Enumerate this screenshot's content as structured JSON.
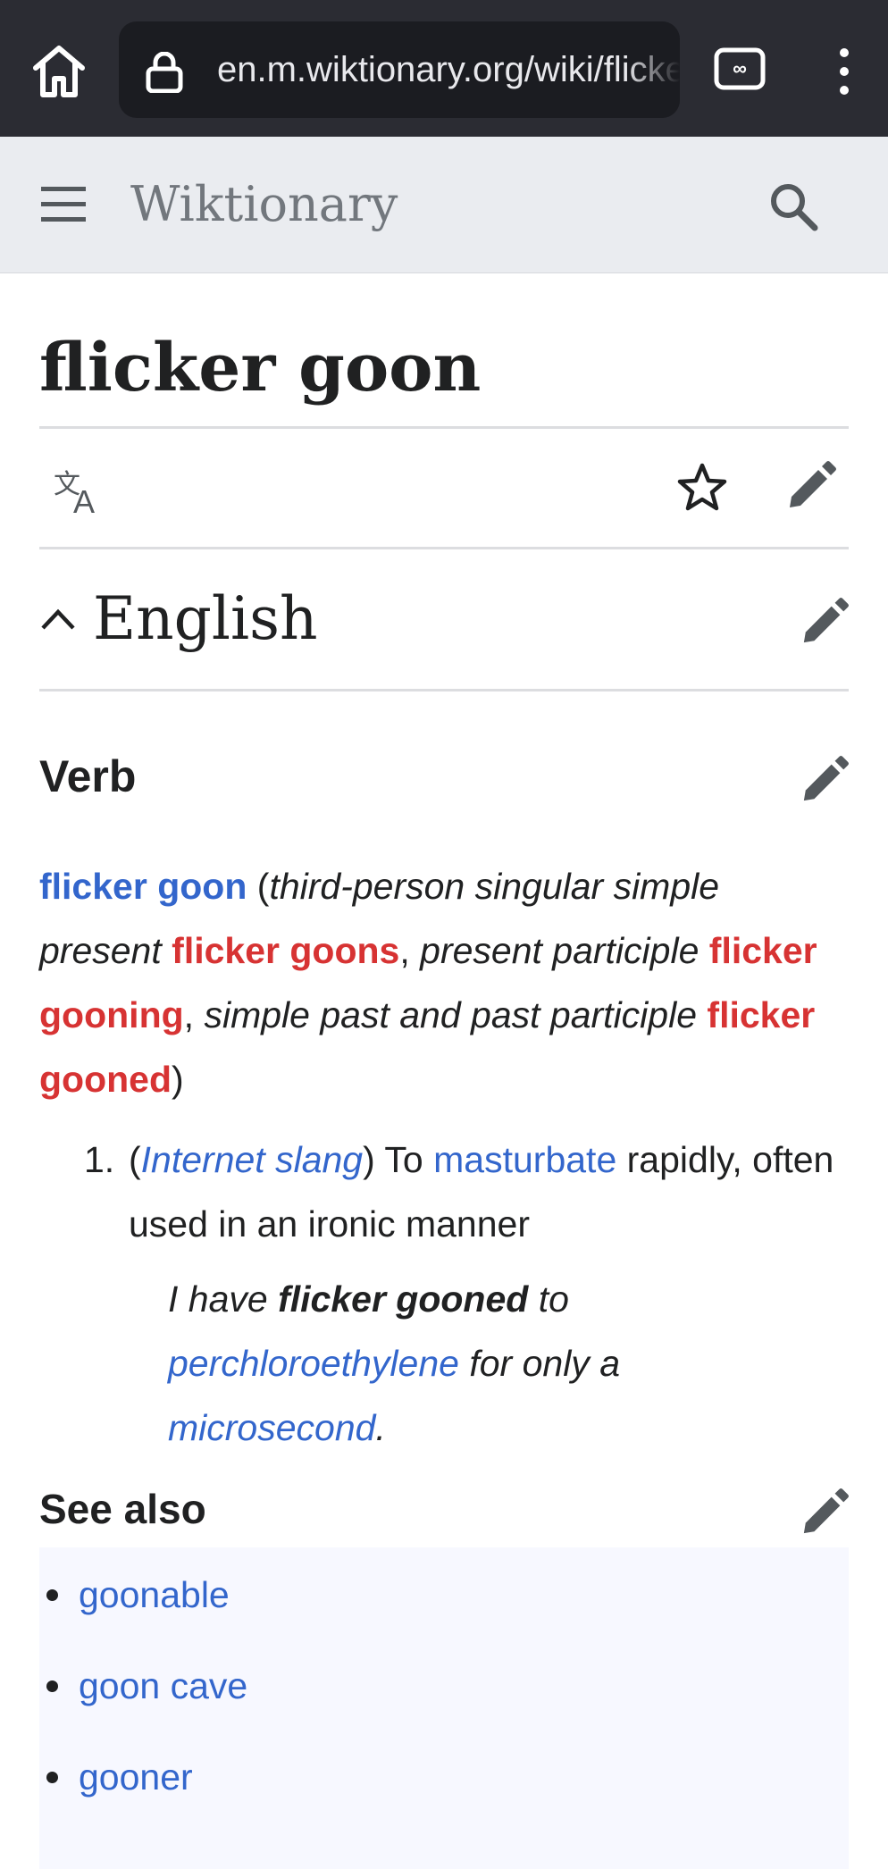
{
  "browser": {
    "url": "en.m.wiktionary.org/wiki/flicker_goon",
    "icons": [
      "home-icon",
      "lock-icon",
      "tabs-icon",
      "menu-icon"
    ]
  },
  "header": {
    "logo": "Wiktionary",
    "icons": [
      "hamburger-icon",
      "search-icon"
    ]
  },
  "page": {
    "title": "flicker goon",
    "actions": [
      "language-icon",
      "star-icon",
      "edit-icon"
    ]
  },
  "section": {
    "title": "English"
  },
  "verb": {
    "heading": "Verb",
    "headword": "flicker goon",
    "open_paren": "(",
    "form1_label": "third-person singular simple present",
    "form1": "flicker goons",
    "sep1": ",",
    "form2_label": "present participle",
    "form2": "flicker gooning",
    "sep2": ",",
    "form3_label": "simple past and past participle",
    "form3": "flicker gooned",
    "close_paren": ")"
  },
  "definitions": [
    {
      "number": "1.",
      "label_open": "(",
      "label": "Internet slang",
      "label_close": ")",
      "text_before": "To",
      "link": "masturbate",
      "text_after": "rapidly, often used in an ironic manner",
      "example": {
        "part1": "I have",
        "bold": "flicker gooned",
        "part2": "to",
        "link1": "perchloroethylene",
        "part3": "for only a",
        "link2": "microsecond",
        "part4": "."
      }
    }
  ],
  "see_also": {
    "heading": "See also",
    "items": [
      "goonable",
      "goon cave",
      "gooner"
    ]
  },
  "colors": {
    "link": "#3366cc",
    "redlink": "#d73333",
    "header_bg": "#eaecf0",
    "browser_bg": "#2b2c33"
  }
}
